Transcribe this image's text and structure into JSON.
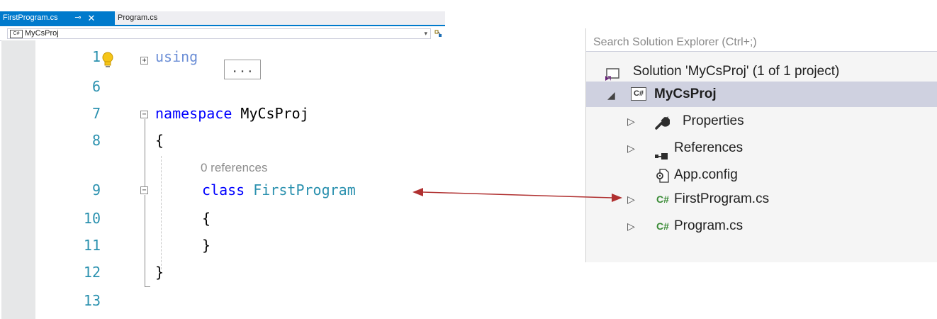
{
  "editor": {
    "tabs": [
      {
        "label": "FirstProgram.cs",
        "pin": "⊸",
        "close": "✕"
      },
      {
        "label": "Program.cs"
      }
    ],
    "nav_project": "MyCsProj",
    "cs_badge": "C#",
    "line_numbers": [
      "1",
      "6",
      "7",
      "8",
      "9",
      "10",
      "11",
      "12",
      "13"
    ],
    "lines": {
      "using_kw": "using",
      "collapsed": "...",
      "namespace_kw": "namespace",
      "namespace_name": " MyCsProj",
      "open_brace_ns": "{",
      "codelens": "0 references",
      "class_kw": "class",
      "class_name": " FirstProgram",
      "open_brace_cls": "{",
      "close_brace_cls": "}",
      "close_brace_ns": "}"
    },
    "fold_expand": "+",
    "fold_collapse": "−"
  },
  "solution_explorer": {
    "search_placeholder": "Search Solution Explorer (Ctrl+;)",
    "solution_label": "Solution 'MyCsProj' (1 of 1 project)",
    "project_label": "MyCsProj",
    "project_badge": "C#",
    "items": [
      {
        "label": "Properties",
        "expandable": true,
        "icon": "wrench-icon"
      },
      {
        "label": "References",
        "expandable": true,
        "icon": "references-icon"
      },
      {
        "label": "App.config",
        "expandable": false,
        "icon": "config-file-icon"
      },
      {
        "label": "FirstProgram.cs",
        "expandable": true,
        "icon": "csharp-file-icon",
        "badge": "C#"
      },
      {
        "label": "Program.cs",
        "expandable": true,
        "icon": "csharp-file-icon",
        "badge": "C#"
      }
    ]
  },
  "colors": {
    "accent": "#007acc",
    "keyword": "#0000ff",
    "type": "#2b91af",
    "line_number": "#2b91af",
    "codelens": "#8e8e8e",
    "selection": "#cfd1e0",
    "arrow": "#b03030"
  }
}
